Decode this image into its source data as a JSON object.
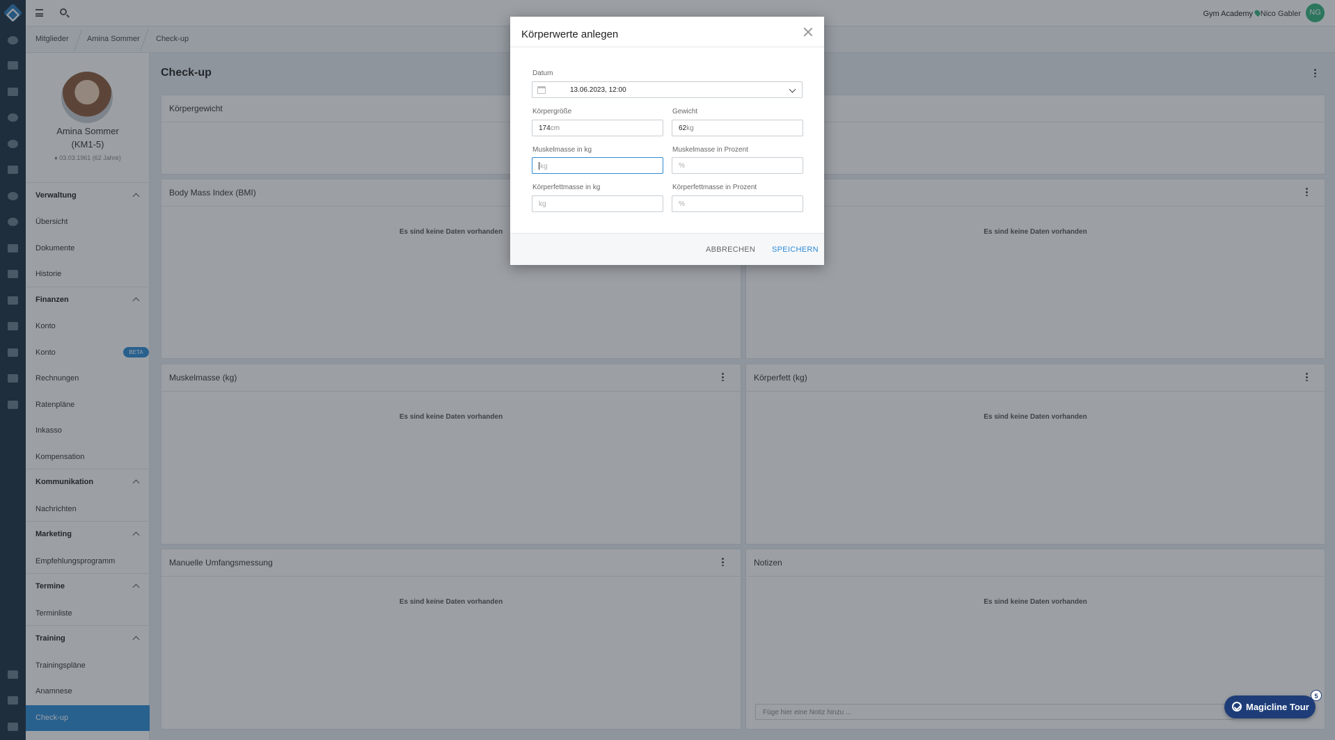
{
  "topbar": {
    "location": "Gym Academy",
    "user_name": "Nico Gabler",
    "user_initials": "NG"
  },
  "breadcrumb": [
    "Mitglieder",
    "Amina Sommer",
    "Check-up"
  ],
  "profile": {
    "name": "Amina Sommer",
    "id": "(KM1-5)",
    "dob": "03.03.1961 (62 Jahre)"
  },
  "sidebar": {
    "sections": [
      {
        "title": "Verwaltung",
        "items": [
          "Übersicht",
          "Dokumente",
          "Historie"
        ]
      },
      {
        "title": "Finanzen",
        "items": [
          "Konto",
          "Konto",
          "Rechnungen",
          "Ratenpläne",
          "Inkasso",
          "Kompensation"
        ]
      },
      {
        "title": "Kommunikation",
        "items": [
          "Nachrichten"
        ]
      },
      {
        "title": "Marketing",
        "items": [
          "Empfehlungsprogramm"
        ]
      },
      {
        "title": "Termine",
        "items": [
          "Terminliste"
        ]
      },
      {
        "title": "Training",
        "items": [
          "Trainingspläne",
          "Anamnese",
          "Check-up"
        ]
      }
    ],
    "beta_badge": "BETA"
  },
  "page": {
    "title": "Check-up",
    "no_data": "Es sind keine Daten vorhanden"
  },
  "cards": {
    "weight": "Körpergewicht",
    "bmi": "Body Mass Index (BMI)",
    "muscle": "Muskelmasse (kg)",
    "fat": "Körperfett (kg)",
    "circumference": "Manuelle Umfangsmessung",
    "notes": "Notizen",
    "notes_placeholder": "Füge hier eine Notiz hinzu ..."
  },
  "modal": {
    "title": "Körperwerte anlegen",
    "date_label": "Datum",
    "date_value": "13.06.2023, 12:00",
    "height_label": "Körpergröße",
    "height_value": "174",
    "height_unit": "cm",
    "weight_label": "Gewicht",
    "weight_value": "62",
    "weight_unit": "kg",
    "muscle_kg_label": "Muskelmasse in kg",
    "muscle_kg_placeholder": "kg",
    "muscle_pct_label": "Muskelmasse in Prozent",
    "muscle_pct_placeholder": "%",
    "fat_kg_label": "Körperfettmasse in kg",
    "fat_kg_placeholder": "kg",
    "fat_pct_label": "Körperfettmasse in Prozent",
    "fat_pct_placeholder": "%",
    "cancel": "ABBRECHEN",
    "save": "SPEICHERN"
  },
  "tour": {
    "label": "Magicline Tour",
    "count": "5"
  },
  "colors": {
    "accent": "#2d8bd6",
    "rail": "#1c3040",
    "tour": "#1e3d78",
    "avatar": "#36b37e"
  }
}
